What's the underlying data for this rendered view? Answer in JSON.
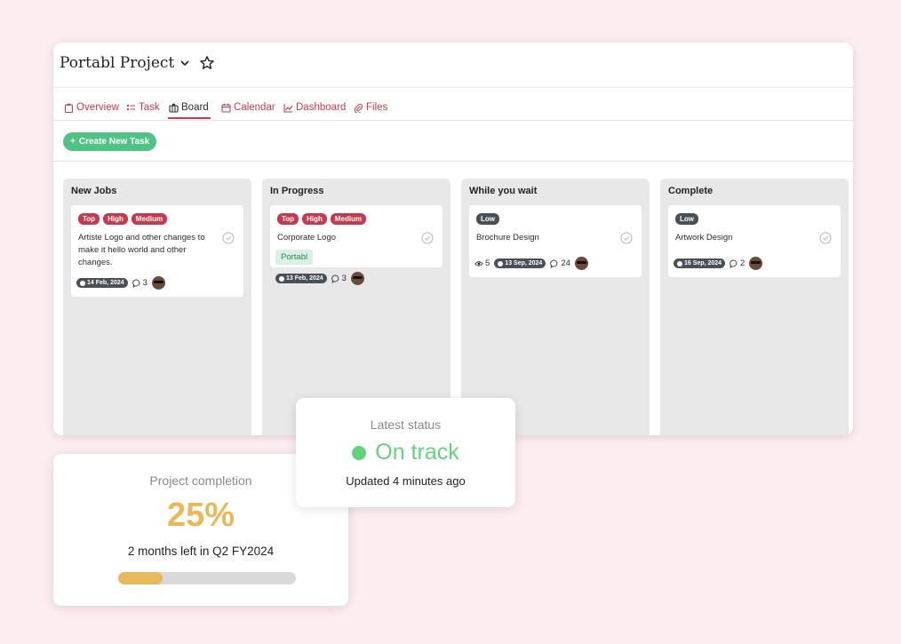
{
  "project": {
    "title": "Portabl Project"
  },
  "tabs": [
    {
      "label": "Overview",
      "icon": "clipboard-icon"
    },
    {
      "label": "Task",
      "icon": "list-icon"
    },
    {
      "label": "Board",
      "icon": "board-icon"
    },
    {
      "label": "Calendar",
      "icon": "calendar-icon"
    },
    {
      "label": "Dashboard",
      "icon": "chart-icon"
    },
    {
      "label": "Files",
      "icon": "paperclip-icon"
    }
  ],
  "active_tab": "Board",
  "toolbar": {
    "create_label": "Create New Task"
  },
  "colors": {
    "accent": "#c6394f",
    "green": "#4fc383",
    "status_green": "#63d27c",
    "progress": "#e8b95a",
    "tag_dark": "#4a5058"
  },
  "columns": [
    {
      "title": "New Jobs",
      "card": {
        "tags": [
          "Top",
          "High",
          "Medium"
        ],
        "title": "Artiste Logo and other changes to make it hello world and other changes.",
        "date": "14 Feb, 2024",
        "comments": "3"
      }
    },
    {
      "title": "In Progress",
      "card": {
        "tags": [
          "Top",
          "High",
          "Medium"
        ],
        "title": "Corporate Logo",
        "label": "Portabl",
        "date": "13 Feb, 2024",
        "comments": "3"
      }
    },
    {
      "title": "While you wait",
      "card": {
        "tags": [
          "Low"
        ],
        "title": "Brochure Design",
        "views": "5",
        "date": "13 Sep, 2024",
        "comments": "24"
      }
    },
    {
      "title": "Complete",
      "card": {
        "tags": [
          "Low"
        ],
        "title": "Artwork Design",
        "date": "16 Sep, 2024",
        "comments": "2"
      }
    }
  ],
  "status": {
    "label": "Latest status",
    "value": "On track",
    "updated": "Updated 4 minutes ago"
  },
  "completion": {
    "label": "Project completion",
    "value": "25%",
    "subtitle": "2 months left in Q2 FY2024",
    "progress_percent": 25
  }
}
